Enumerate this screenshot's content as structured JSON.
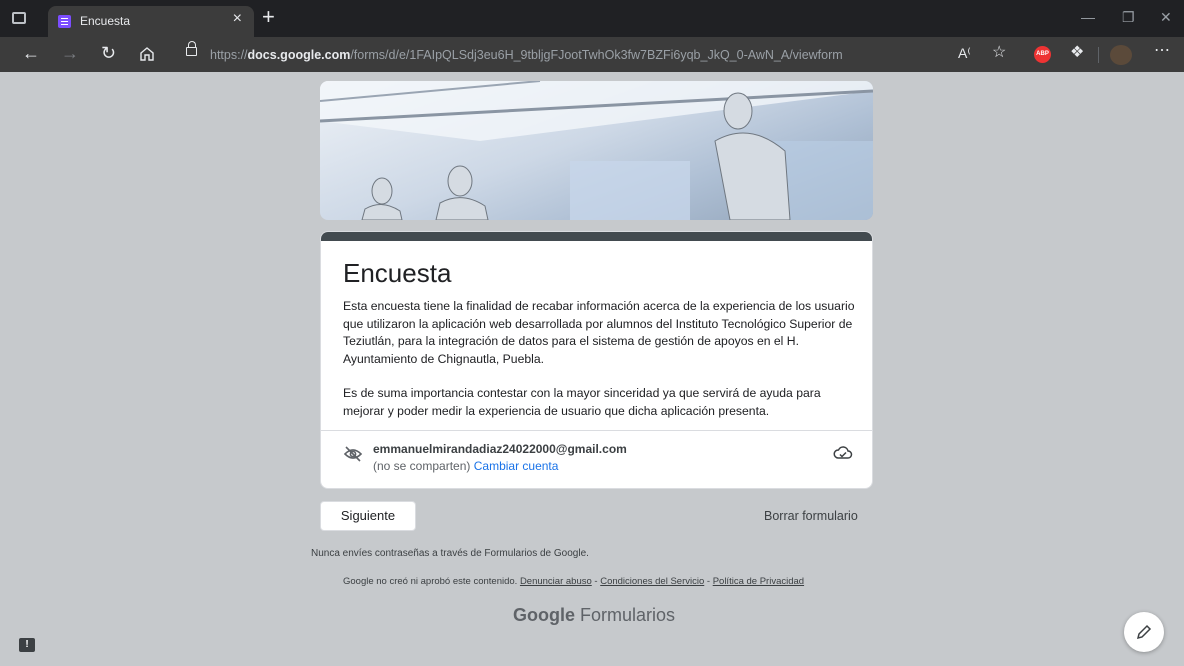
{
  "browser": {
    "tab_title": "Encuesta",
    "new_tab_glyph": "+",
    "close_glyph": "×",
    "url_prefix": "https://",
    "url_domain": "docs.google.com",
    "url_path": "/forms/d/e/1FAIpQLSdj3eu6H_9tbljgFJootTwhOk3fw7BZFi6yqb_JkQ_0-AwN_A/viewform",
    "abp_label": "ABP",
    "icons": [
      "back-icon",
      "forward-icon",
      "refresh-icon",
      "home-icon",
      "lock-icon",
      "read-aloud-icon",
      "favorites-icon",
      "extensions-icon",
      "more-icon"
    ]
  },
  "form": {
    "title": "Encuesta",
    "description_p1": "Esta encuesta tiene la finalidad de recabar información acerca de la experiencia de los usuario que utilizaron la aplicación web desarrollada por alumnos del Instituto Tecnológico Superior de Teziutlán, para la integración de datos para el sistema de gestión de apoyos en el H. Ayuntamiento de Chignautla, Puebla.",
    "description_p2": "Es de suma importancia contestar con la mayor sinceridad ya que servirá de ayuda para mejorar y poder medir la experiencia de usuario que dicha aplicación presenta.",
    "account_email": "emmanuelmirandadiaz24022000@gmail.com",
    "account_note": "(no se comparten)",
    "change_account": "Cambiar cuenta",
    "accent_color": "#424a4f"
  },
  "actions": {
    "next": "Siguiente",
    "clear": "Borrar formulario"
  },
  "footer": {
    "password_warning": "Nunca envíes contraseñas a través de Formularios de Google.",
    "disclaimer": "Google no creó ni aprobó este contenido.",
    "report_abuse": "Denunciar abuso",
    "terms": "Condiciones del Servicio",
    "privacy": "Política de Privacidad",
    "brand_google": "Google",
    "brand_product": "Formularios"
  },
  "feedback_glyph": "!"
}
